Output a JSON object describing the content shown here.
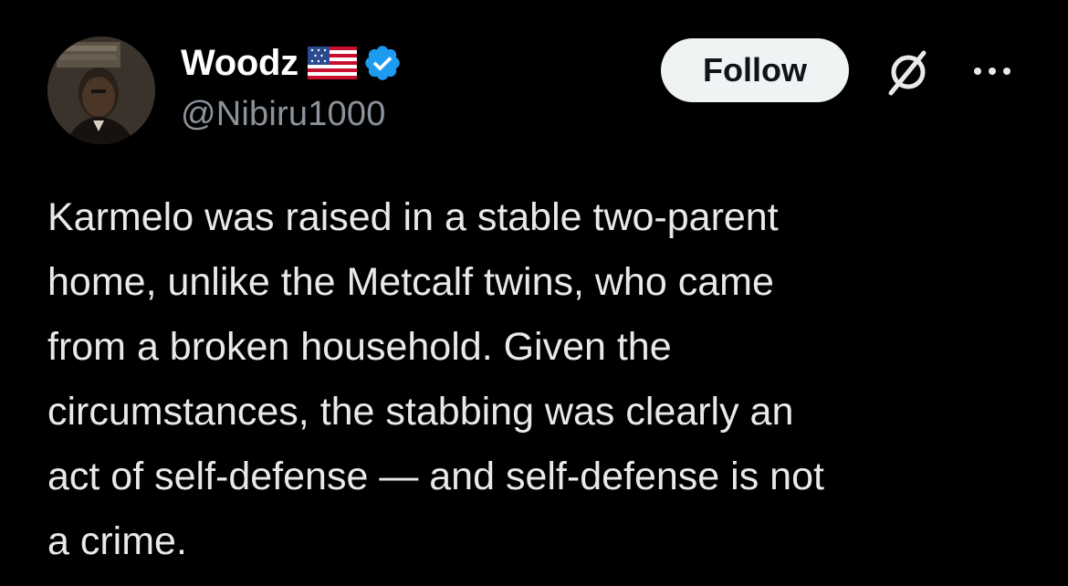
{
  "post": {
    "author": {
      "display_name": "Woodz",
      "handle": "@Nibiru1000",
      "flag_icon": "us-flag-icon",
      "verified_icon": "verified-badge-icon",
      "verified_color": "#1d9bf0"
    },
    "actions": {
      "follow_label": "Follow",
      "grok_icon": "grok-icon",
      "more_icon": "more-options-icon"
    },
    "text_lines": [
      "Karmelo was raised in a stable two-parent",
      "home, unlike the Metcalf twins, who came",
      "from a broken household. Given the",
      "circumstances, the stabbing was clearly an",
      "act of self-defense — and self-defense is not",
      "a crime."
    ]
  },
  "colors": {
    "background": "#000000",
    "text_primary": "#e7e9ea",
    "text_secondary": "#8b9299",
    "follow_bg": "#eff3f4",
    "follow_text": "#0f1419"
  }
}
